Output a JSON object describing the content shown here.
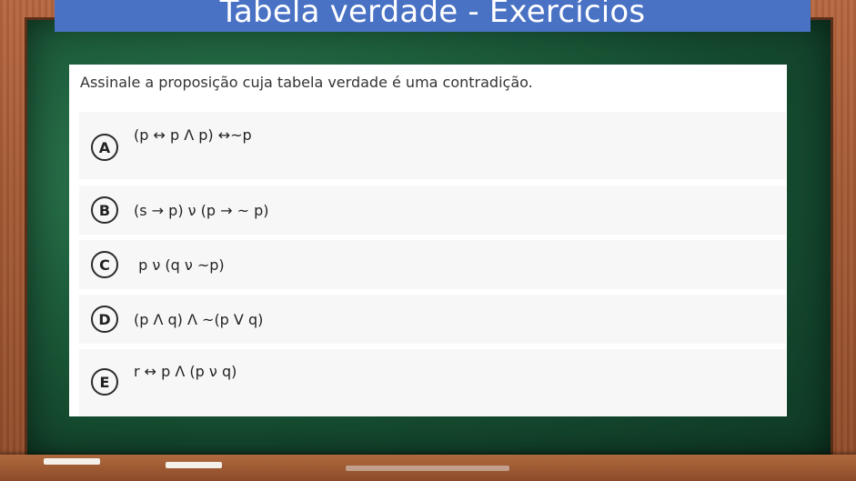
{
  "header": {
    "title": "Tabela verdade - Exercícios"
  },
  "question": {
    "text": "Assinale a proposição cuja tabela verdade é uma contradição."
  },
  "options": [
    {
      "letter": "A",
      "text": "(p ↔ p Λ p) ↔~p"
    },
    {
      "letter": "B",
      "text": "(s → p) ν (p → ~ p)"
    },
    {
      "letter": "C",
      "text": " p ν (q ν ~p)"
    },
    {
      "letter": "D",
      "text": "(p Λ q) Λ ~(p V q)"
    },
    {
      "letter": "E",
      "text": "r ↔ p Λ (p ν q)"
    }
  ],
  "colors": {
    "title_bar": "#4a72c4",
    "board": "#1e5f3d",
    "frame": "#a55a34",
    "card": "#ffffff",
    "option_bg": "#f7f7f7"
  }
}
